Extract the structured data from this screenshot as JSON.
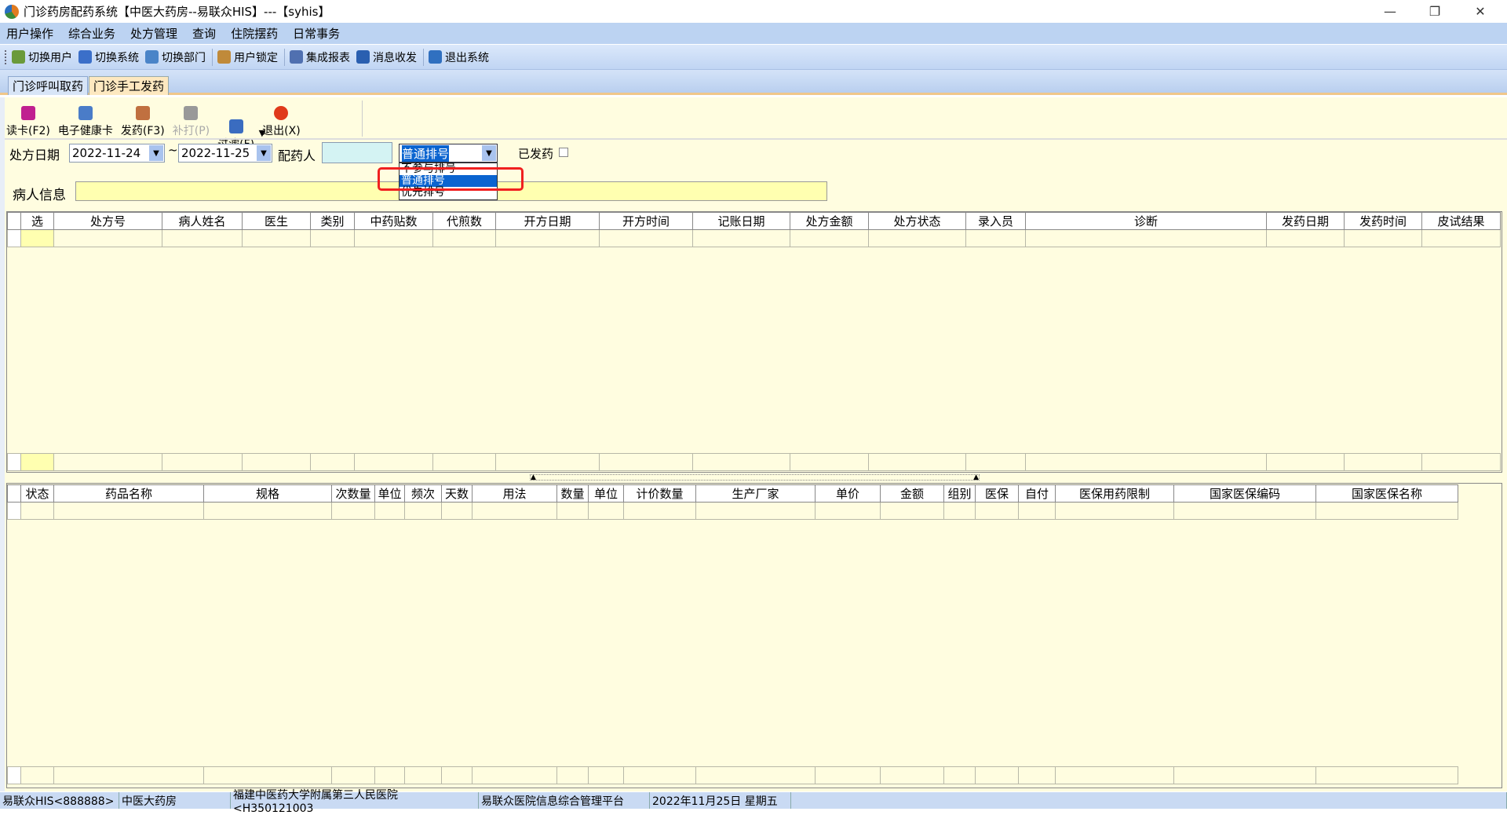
{
  "window": {
    "title": "门诊药房配药系统【中医大药房--易联众HIS】---【syhis】",
    "minimize": "—",
    "restore": "❐",
    "close": "✕"
  },
  "menu": [
    "用户操作",
    "综合业务",
    "处方管理",
    "查询",
    "住院摆药",
    "日常事务"
  ],
  "toolbar": [
    "切换用户",
    "切换系统",
    "切换部门",
    "用户锁定",
    "集成报表",
    "消息收发",
    "退出系统"
  ],
  "tabs": [
    "门诊呼叫取药",
    "门诊手工发药"
  ],
  "actions": [
    "读卡(F2)",
    "电子健康卡",
    "发药(F3)",
    "补打(P)",
    "过滤(F)",
    "退出(X)"
  ],
  "filter": {
    "date_label": "处方日期",
    "date_from": "2022-11-24",
    "tilde": "~",
    "date_to": "2022-11-25",
    "dispenser_label": "配药人",
    "dispenser_value": "",
    "queue_value": "普通排号",
    "queue_options": [
      "不参与排号",
      "普通排号",
      "优先排号"
    ],
    "dispensed_label": "已发药",
    "dispensed_checked": false
  },
  "patient": {
    "label": "病人信息",
    "value": ""
  },
  "grid1": {
    "columns": [
      "选",
      "处方号",
      "病人姓名",
      "医生",
      "类别",
      "中药贴数",
      "代煎数",
      "开方日期",
      "开方时间",
      "记账日期",
      "处方金额",
      "处方状态",
      "录入员",
      "诊断",
      "发药日期",
      "发药时间",
      "皮试结果"
    ]
  },
  "grid2": {
    "columns": [
      "状态",
      "药品名称",
      "规格",
      "次数量",
      "单位",
      "频次",
      "天数",
      "用法",
      "数量",
      "单位",
      "计价数量",
      "生产厂家",
      "单价",
      "金额",
      "组别",
      "医保",
      "自付",
      "医保用药限制",
      "国家医保编码",
      "国家医保名称"
    ]
  },
  "status": [
    "易联众HIS<888888>",
    "中医大药房",
    "福建中医药大学附属第三人民医院<H350121003",
    "易联众医院信息综合管理平台",
    "2022年11月25日 星期五",
    ""
  ]
}
